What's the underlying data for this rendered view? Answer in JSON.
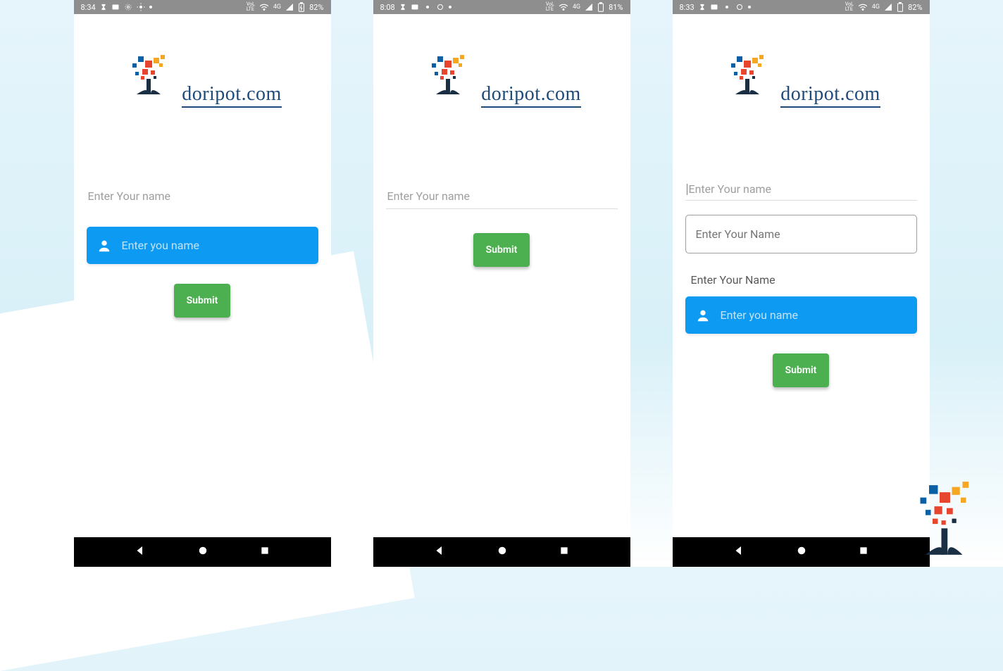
{
  "brand": "doripot.com",
  "submit_label": "Submit",
  "phone1": {
    "time": "8:34",
    "battery": "82%",
    "net": "4G",
    "input1_placeholder": "Enter Your name",
    "blue_placeholder": "Enter you name"
  },
  "phone2": {
    "time": "8:08",
    "battery": "81%",
    "net": "4G",
    "input1_placeholder": "Enter Your name"
  },
  "phone3": {
    "time": "8:33",
    "battery": "82%",
    "net": "4G",
    "input1_placeholder": "Enter Your name",
    "outlined_placeholder": "Enter Your Name",
    "plain_label": "Enter Your Name",
    "blue_placeholder": "Enter you name"
  }
}
